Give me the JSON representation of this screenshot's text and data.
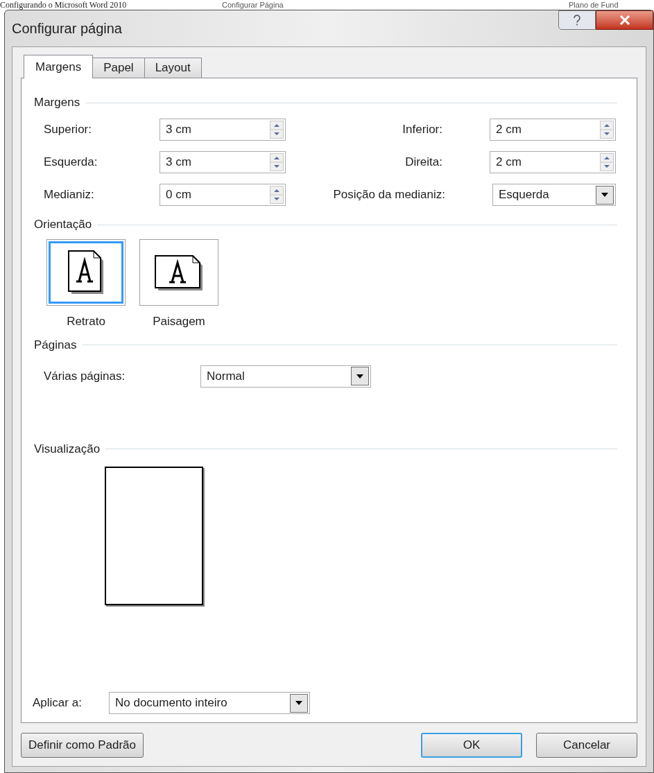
{
  "caption": "Configurando o Microsoft Word 2010",
  "background": {
    "left": "Configurar Página",
    "right": "Plano de Fund"
  },
  "window": {
    "title": "Configurar página"
  },
  "tabs": [
    {
      "label": "Margens",
      "selected": true
    },
    {
      "label": "Papel",
      "selected": false
    },
    {
      "label": "Layout",
      "selected": false
    }
  ],
  "margins": {
    "heading": "Margens",
    "fields": [
      {
        "kind": "spin",
        "label": "Superior:",
        "value": "3 cm"
      },
      {
        "kind": "spin",
        "label": "Inferior:",
        "value": "2 cm"
      },
      {
        "kind": "spin",
        "label": "Esquerda:",
        "value": "3 cm"
      },
      {
        "kind": "spin",
        "label": "Direita:",
        "value": "2 cm"
      },
      {
        "kind": "spin",
        "label": "Medianiz:",
        "value": "0 cm"
      },
      {
        "kind": "dropdown",
        "label": "Posição da medianiz:",
        "value": "Esquerda"
      }
    ]
  },
  "orientation": {
    "heading": "Orientação",
    "options": [
      {
        "kind": "portrait",
        "label": "Retrato",
        "selected": true
      },
      {
        "kind": "landscape",
        "label": "Paisagem",
        "selected": false
      }
    ]
  },
  "pages": {
    "heading": "Páginas",
    "label": "Várias páginas:",
    "value": "Normal"
  },
  "preview": {
    "heading": "Visualização"
  },
  "apply_to": {
    "label": "Aplicar a:",
    "value": "No documento inteiro"
  },
  "buttons": [
    {
      "kind": "left",
      "label": "Definir como Padrão",
      "selected": false
    },
    {
      "kind": "right",
      "label": "OK",
      "selected": true
    },
    {
      "kind": "right",
      "label": "Cancelar",
      "selected": false
    }
  ]
}
